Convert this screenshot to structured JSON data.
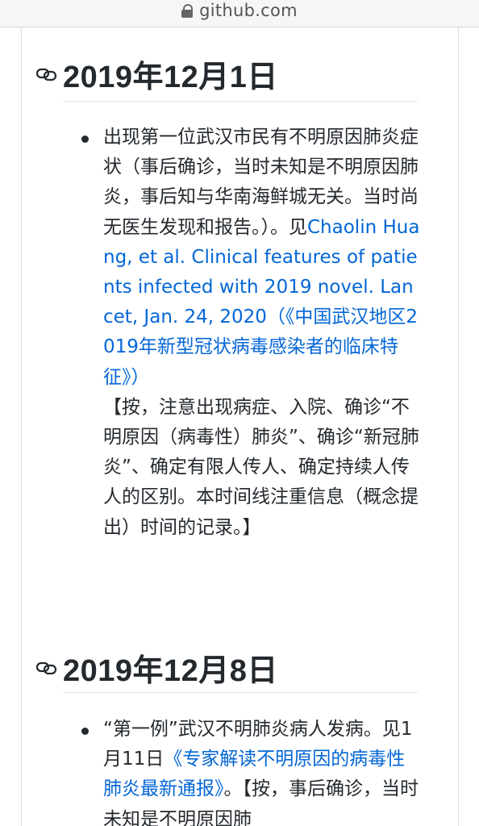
{
  "browser": {
    "domain": "github.com"
  },
  "sections": [
    {
      "heading": "2019年12月1日",
      "item": {
        "text1": "出现第一位武汉市民有不明原因肺炎症状（事后确诊，当时未知是不明原因肺炎，事后知与华南海鲜城无关。当时尚无医生发现和报告。）。见",
        "link": "Chaolin Huang, et al. Clinical features of patients infected with 2019 novel. Lancet, Jan. 24, 2020（《中国武汉地区2019年新型冠状病毒感染者的临床特征》）",
        "note": "【按，注意出现病症、入院、确诊“不明原因（病毒性）肺炎”、确诊“新冠肺炎”、确定有限人传人、确定持续人传人的区别。本时间线注重信息（概念提出）时间的记录。】"
      }
    },
    {
      "heading": "2019年12月8日",
      "item": {
        "text1": "“第一例”武汉不明肺炎病人发病。见1月11日",
        "link": "《专家解读不明原因的病毒性肺炎最新通报》",
        "text2": "。【按，事后确诊，当时未知是不明原因肺"
      }
    }
  ]
}
